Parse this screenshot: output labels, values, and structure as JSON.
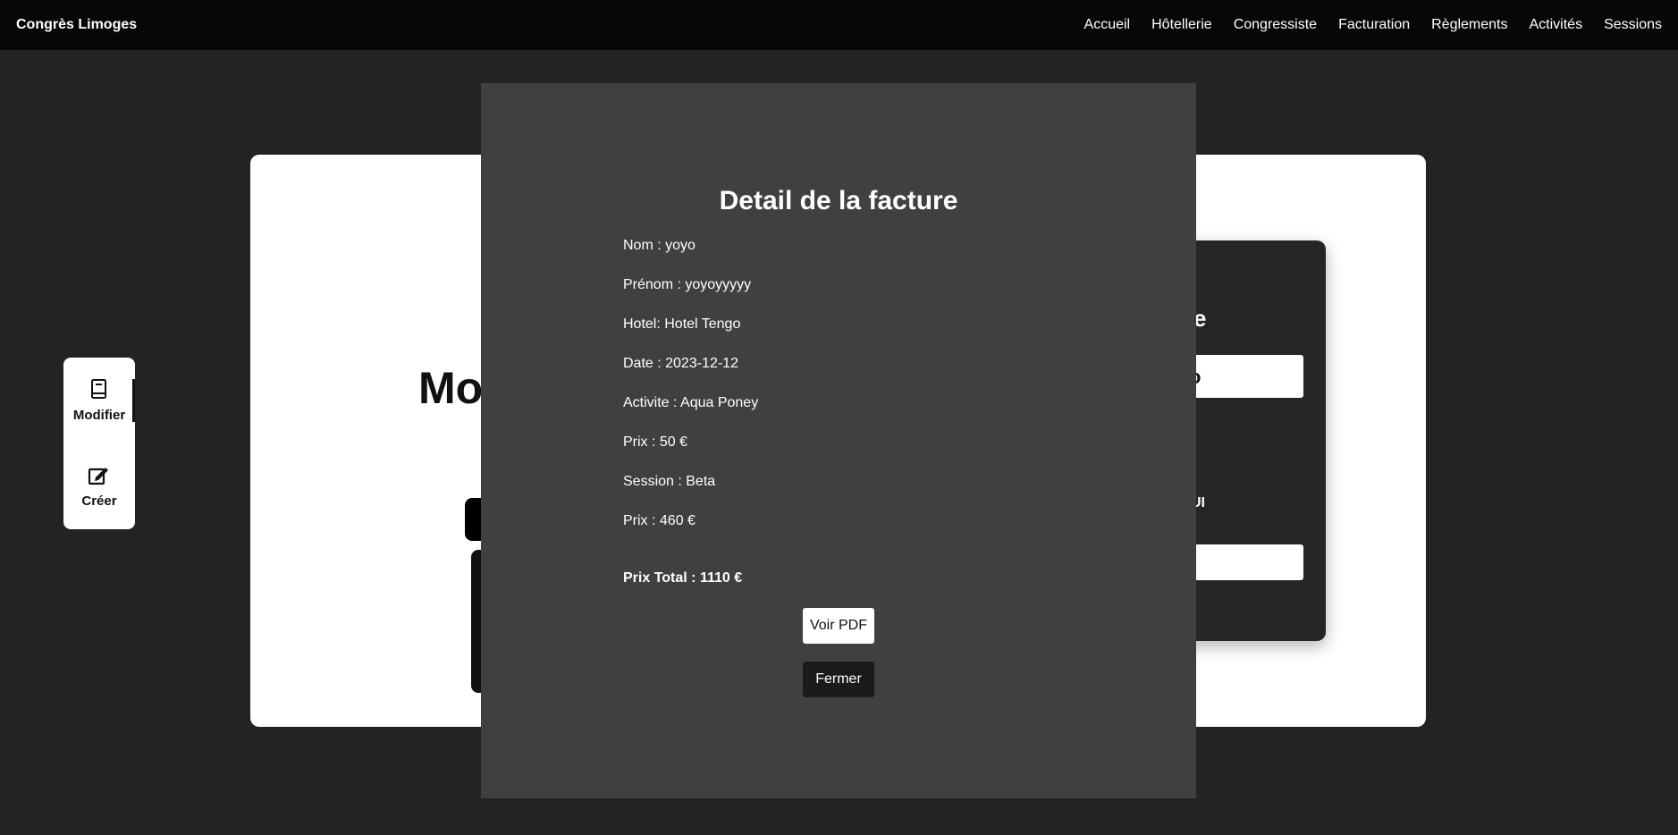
{
  "app": {
    "brand": "Congrès Limoges"
  },
  "nav": {
    "items": [
      {
        "label": "Accueil"
      },
      {
        "label": "Hôtellerie"
      },
      {
        "label": "Congressiste"
      },
      {
        "label": "Facturation"
      },
      {
        "label": "Règlements"
      },
      {
        "label": "Activités"
      },
      {
        "label": "Sessions"
      }
    ]
  },
  "sidebar": {
    "items": [
      {
        "label": "Modifier",
        "icon": "book-icon"
      },
      {
        "label": "Créer",
        "icon": "edit-icon"
      }
    ]
  },
  "main": {
    "title_partial": "Mo"
  },
  "background_card": {
    "heading_partial": "e",
    "field_text_partial": "o",
    "label_partial": "UI"
  },
  "modal": {
    "title": "Detail de la facture",
    "lines": [
      "Nom : yoyo",
      "Prénom : yoyoyyyyy",
      "Hotel: Hotel Tengo",
      "Date : 2023-12-12",
      "Activite : Aqua Poney",
      "Prix : 50 €",
      "Session : Beta",
      "Prix : 460 €"
    ],
    "total": "Prix Total : 1110 €",
    "pdf_button": "Voir PDF",
    "close_button": "Fermer"
  },
  "colors": {
    "background": "#232323",
    "navbar": "#070707",
    "modal": "#404040",
    "card": "#ffffff"
  }
}
